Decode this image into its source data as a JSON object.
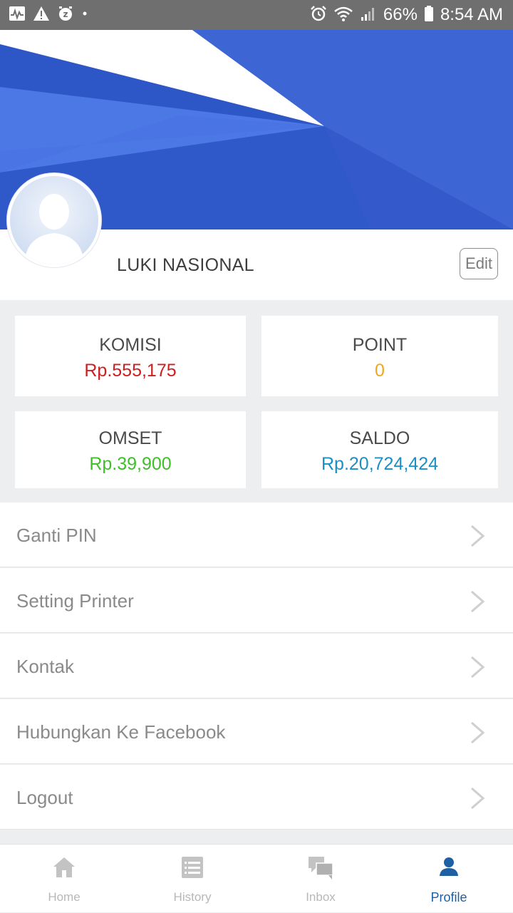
{
  "status_bar": {
    "battery": "66%",
    "time": "8:54 AM",
    "icons_left": [
      "pulse-icon",
      "warning-icon",
      "z-icon",
      "dot-icon"
    ],
    "icons_right": [
      "alarm-icon",
      "wifi-icon",
      "signal-icon",
      "battery-icon"
    ]
  },
  "profile": {
    "name": "LUKI NASIONAL",
    "edit_label": "Edit",
    "avatar_icon": "avatar-placeholder-icon"
  },
  "stats": {
    "komisi": {
      "label": "KOMISI",
      "value": "Rp.555,175",
      "color": "#cc1f1f"
    },
    "point": {
      "label": "POINT",
      "value": "0",
      "color": "#f0a81c"
    },
    "omset": {
      "label": "OMSET",
      "value": "Rp.39,900",
      "color": "#3fbf2a"
    },
    "saldo": {
      "label": "SALDO",
      "value": "Rp.20,724,424",
      "color": "#1b8fc4"
    }
  },
  "menu": [
    {
      "label": "Ganti PIN"
    },
    {
      "label": "Setting Printer"
    },
    {
      "label": "Kontak"
    },
    {
      "label": "Hubungkan Ke Facebook"
    },
    {
      "label": "Logout"
    }
  ],
  "bottom_nav": [
    {
      "label": "Home",
      "icon": "home-icon",
      "active": false
    },
    {
      "label": "History",
      "icon": "list-icon",
      "active": false
    },
    {
      "label": "Inbox",
      "icon": "chat-icon",
      "active": false
    },
    {
      "label": "Profile",
      "icon": "person-icon",
      "active": true
    }
  ],
  "colors": {
    "accent": "#1f5fa3",
    "banner_blue": "#3f6ad8"
  }
}
